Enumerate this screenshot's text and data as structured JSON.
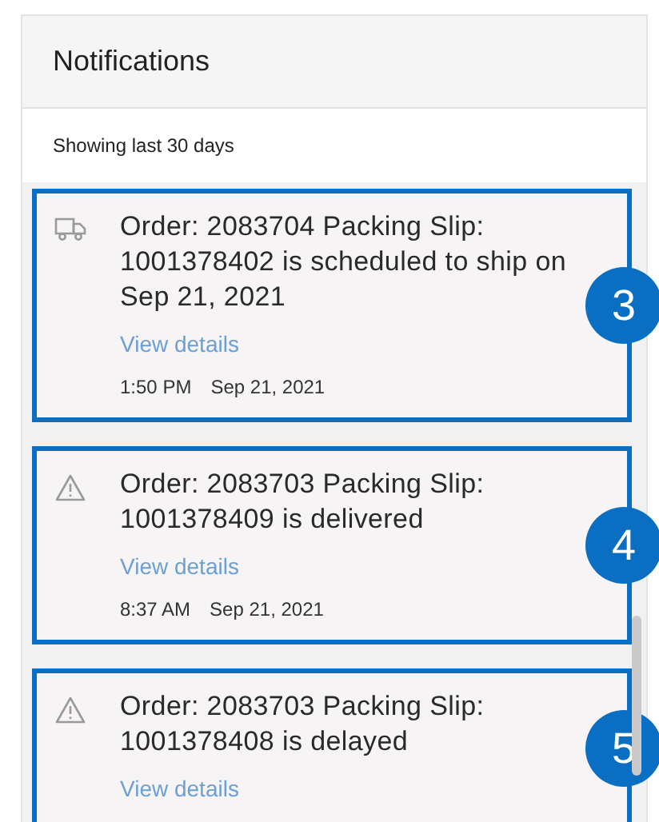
{
  "header": {
    "title": "Notifications"
  },
  "subheader": "Showing last 30 days",
  "notifications": [
    {
      "kind": "truck",
      "message": "Order: 2083704 Packing Slip: 1001378402 is scheduled to ship on Sep 21, 2021",
      "link": "View details",
      "time": "1:50 PM",
      "date": "Sep 21, 2021",
      "highlighted": true,
      "callout": "3"
    },
    {
      "kind": "warning",
      "message": "Order: 2083703 Packing Slip: 1001378409 is delivered",
      "link": "View details",
      "time": "8:37 AM",
      "date": "Sep 21, 2021",
      "highlighted": true,
      "callout": "4"
    },
    {
      "kind": "warning",
      "message": "Order: 2083703 Packing Slip: 1001378408 is delayed",
      "link": "View details",
      "highlighted": true,
      "callout": "5"
    }
  ]
}
